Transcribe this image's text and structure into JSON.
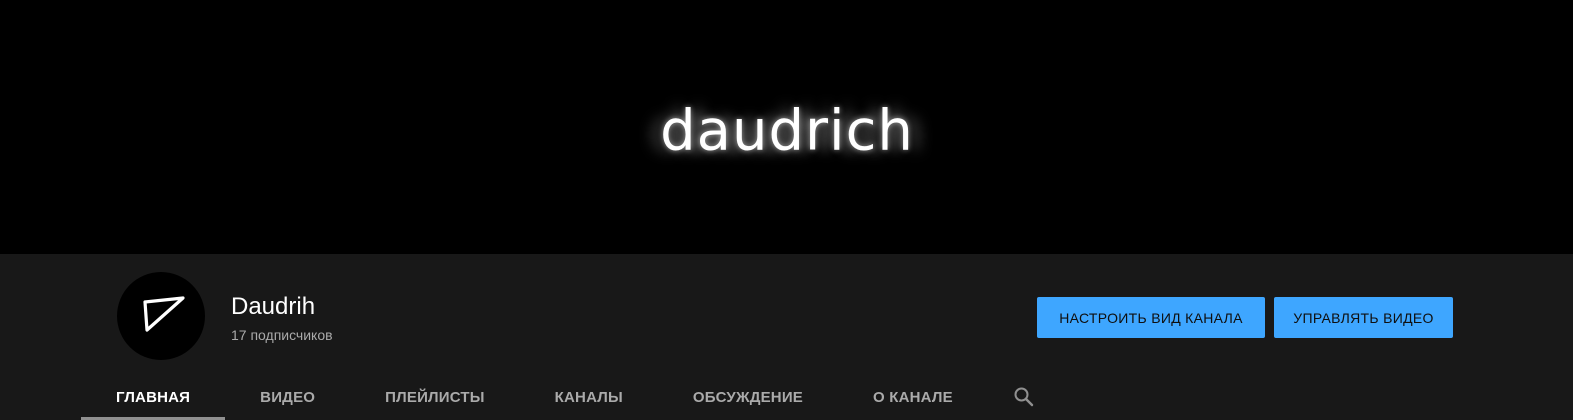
{
  "banner": {
    "logo_text": "daudrich"
  },
  "channel": {
    "name": "Daudrih",
    "subscribers": "17 подписчиков"
  },
  "buttons": {
    "customize": "НАСТРОИТЬ ВИД КАНАЛА",
    "manage": "УПРАВЛЯТЬ ВИДЕО"
  },
  "tabs": [
    {
      "label": "ГЛАВНАЯ",
      "active": true
    },
    {
      "label": "ВИДЕО",
      "active": false
    },
    {
      "label": "ПЛЕЙЛИСТЫ",
      "active": false
    },
    {
      "label": "КАНАЛЫ",
      "active": false
    },
    {
      "label": "ОБСУЖДЕНИЕ",
      "active": false
    },
    {
      "label": "О КАНАЛЕ",
      "active": false
    }
  ],
  "icons": {
    "search": "search-icon",
    "avatar": "channel-logo-icon"
  },
  "colors": {
    "accent": "#3ea6ff",
    "background": "#181818",
    "banner": "#000000",
    "text_primary": "#ffffff",
    "text_secondary": "#aaaaaa"
  }
}
